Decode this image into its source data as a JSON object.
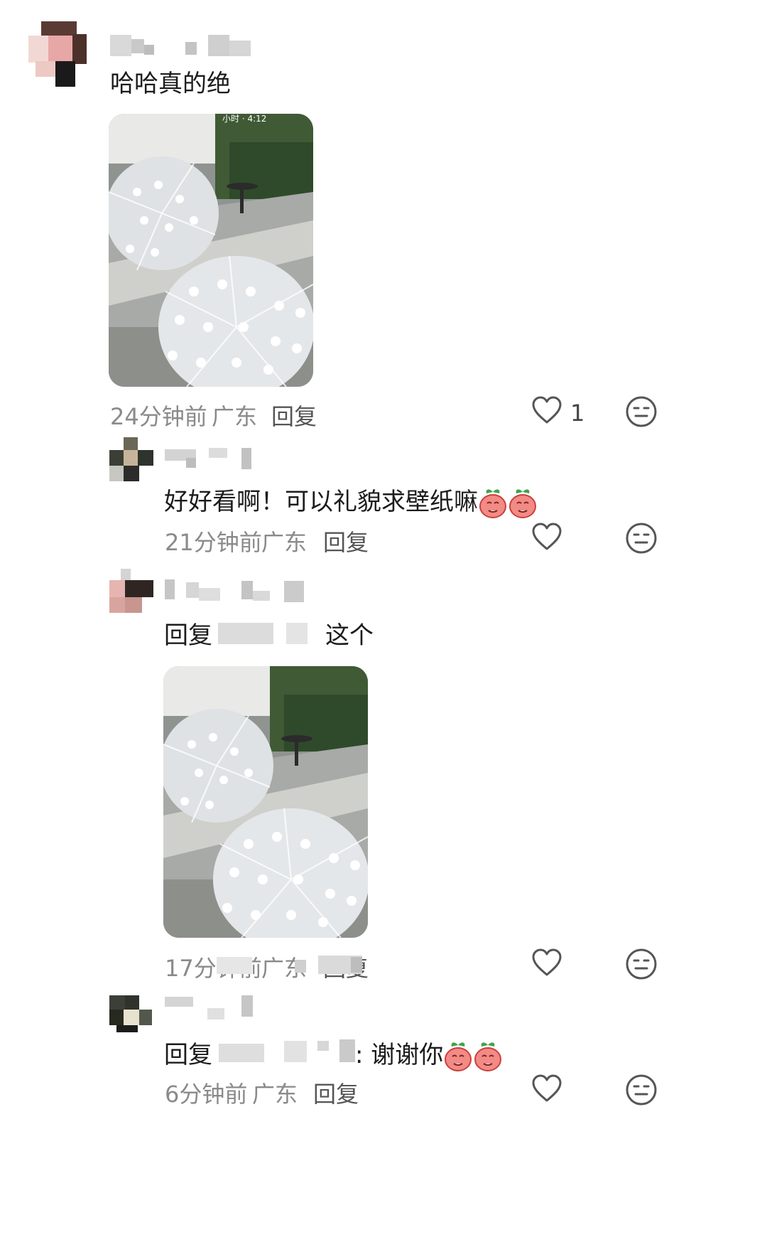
{
  "comments": [
    {
      "text": "哈哈真的绝",
      "time": "24分钟前",
      "location": "广东",
      "reply_label": "回复",
      "like_count": "1",
      "image": "photo-umbrellas",
      "overlay_text": "小时 · 4:12"
    },
    {
      "text": "好好看啊！可以礼貌求壁纸嘛",
      "emojis": [
        "peach-emoji",
        "peach-emoji"
      ],
      "time": "21分钟前",
      "location": "广东",
      "reply_label": "回复"
    },
    {
      "reply_prefix": "回复",
      "text": "这个",
      "image": "photo-umbrellas",
      "time": "17分钟前",
      "location": "广东",
      "reply_label": "回复"
    },
    {
      "reply_prefix": "回复",
      "text": ": 谢谢你",
      "emojis": [
        "peach-emoji",
        "peach-emoji"
      ],
      "time": "6分钟前",
      "location": "广东",
      "reply_label": "回复"
    }
  ],
  "colors": {
    "meta_gray": "#8a8a8a",
    "icon_gray": "#555555"
  },
  "icons": {
    "like": "heart-outline-icon",
    "reaction": "neutral-face-icon"
  }
}
